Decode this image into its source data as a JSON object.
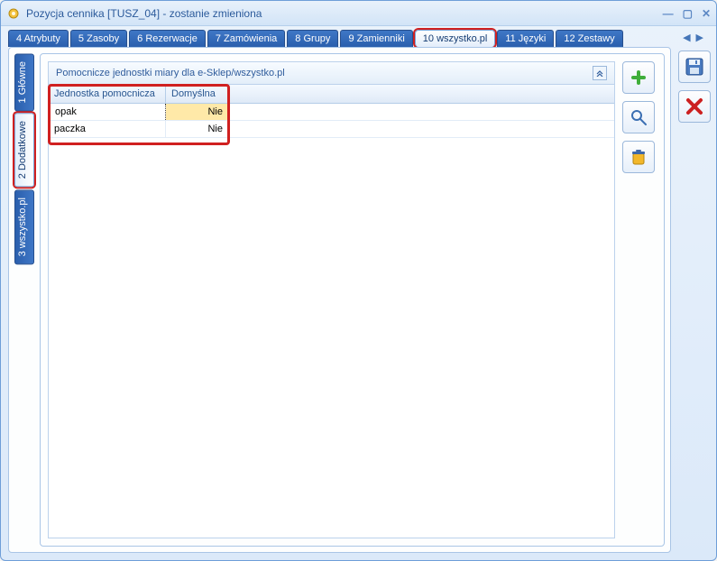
{
  "window": {
    "title": "Pozycja cennika [TUSZ_04] - zostanie zmieniona"
  },
  "tabs": {
    "items": [
      {
        "label": "4 Atrybuty"
      },
      {
        "label": "5 Zasoby"
      },
      {
        "label": "6 Rezerwacje"
      },
      {
        "label": "7 Zamówienia"
      },
      {
        "label": "8 Grupy"
      },
      {
        "label": "9 Zamienniki"
      },
      {
        "label": "10 wszystko.pl"
      },
      {
        "label": "11 Języki"
      },
      {
        "label": "12 Zestawy"
      }
    ],
    "active_index": 6
  },
  "vertical_tabs": {
    "items": [
      {
        "label": "1 Główne"
      },
      {
        "label": "2 Dodatkowe"
      },
      {
        "label": "3 wszystko.pl"
      }
    ],
    "active_index": 1
  },
  "grid": {
    "panel_title": "Pomocnicze jednostki miary dla e-Sklep/wszystko.pl",
    "columns": {
      "unit": "Jednostka pomocnicza",
      "default": "Domyślna"
    },
    "rows": [
      {
        "unit": "opak",
        "default": "Nie",
        "selected": true
      },
      {
        "unit": "paczka",
        "default": "Nie",
        "selected": false
      }
    ]
  },
  "icons": {
    "save": "save-icon",
    "close": "close-icon",
    "add": "add-icon",
    "search": "search-icon",
    "delete": "delete-icon"
  },
  "colors": {
    "accent": "#2a5fad",
    "highlight": "#d02020",
    "selected_cell": "#ffe9a8"
  }
}
